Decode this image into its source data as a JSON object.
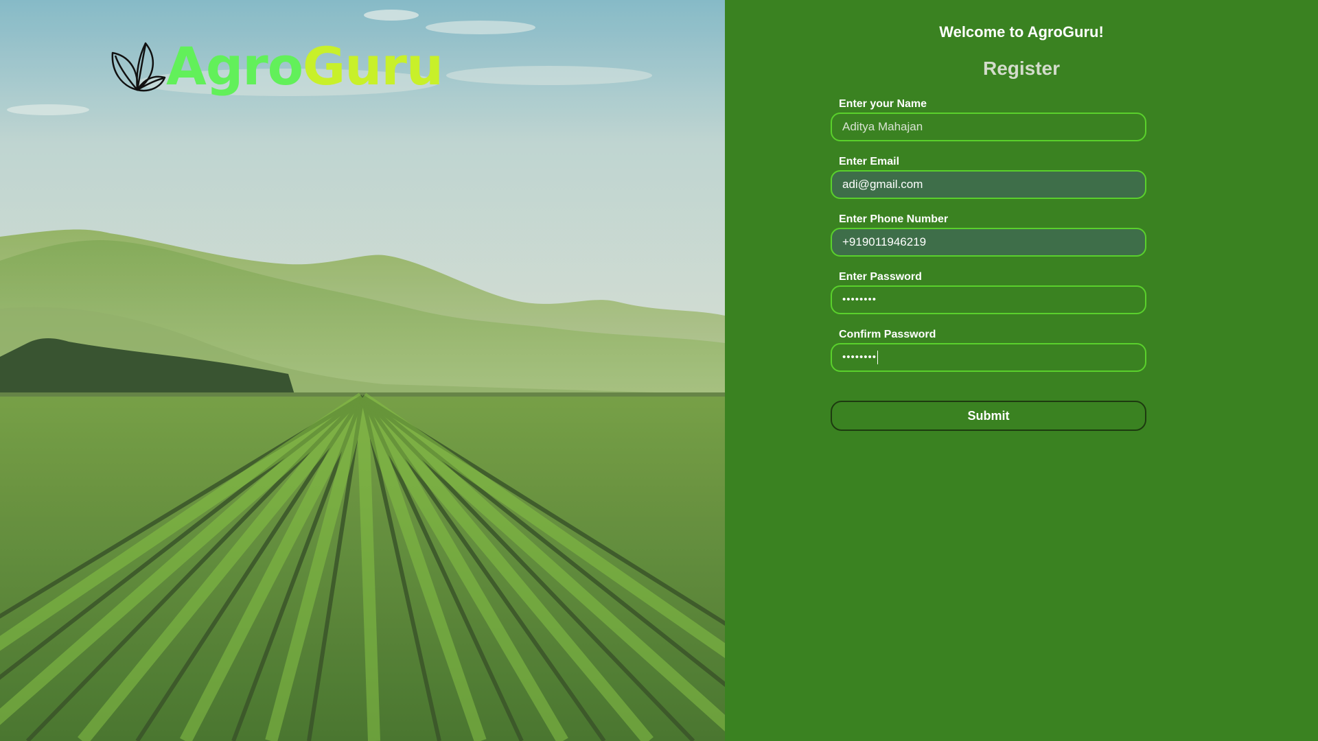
{
  "brand": {
    "name_part1": "Agro",
    "name_part2": "Guru",
    "logo_icon": "leaf-logo-icon",
    "color_part1": "#62f05a",
    "color_part2": "#c8f02a"
  },
  "hero": {
    "image": "vineyard-landscape-photo"
  },
  "form": {
    "welcome": "Welcome to AgroGuru!",
    "title": "Register",
    "fields": [
      {
        "label": "Enter your Name",
        "value": "Aditya Mahajan"
      },
      {
        "label": "Enter Email",
        "value": "adi@gmail.com"
      },
      {
        "label": "Enter Phone Number",
        "value": "+919011946219"
      },
      {
        "label": "Enter Password",
        "value": "••••••••"
      },
      {
        "label": "Confirm Password",
        "value": "••••••••"
      }
    ],
    "submit_label": "Submit"
  },
  "colors": {
    "panel_bg": "#3a8221",
    "input_border": "#5ad12c",
    "filled_input_bg": "#3e6e49"
  }
}
